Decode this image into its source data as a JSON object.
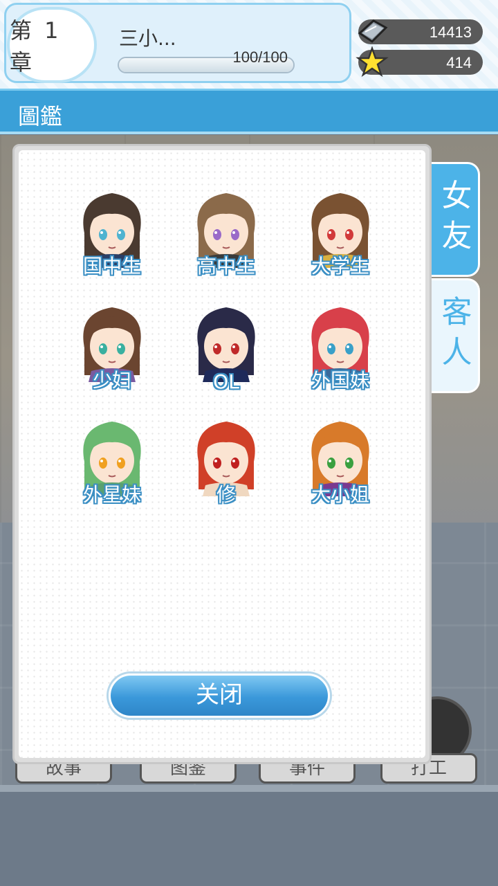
{
  "header": {
    "chapter": "第 1 章",
    "character_name": "三小...",
    "progress_text": "100/100",
    "progress": 1.0
  },
  "currency": {
    "gems": "14413",
    "stars": "414"
  },
  "title": "圖鑑",
  "tabs": [
    {
      "label": "女友",
      "active": true
    },
    {
      "label": "客人",
      "active": false
    }
  ],
  "characters": [
    {
      "label": "国中生",
      "hair": "#4a3a30",
      "eye": "#4fb3d0",
      "outfit": "#2a3f66"
    },
    {
      "label": "高中生",
      "hair": "#8b6a4a",
      "eye": "#9a6ac8",
      "outfit": "#3a3a3a"
    },
    {
      "label": "大学生",
      "hair": "#7a5232",
      "eye": "#d23a3a",
      "outfit": "#d8b040"
    },
    {
      "label": "少妇",
      "hair": "#6b4530",
      "eye": "#3ab0a0",
      "outfit": "#7a5aa0"
    },
    {
      "label": "OL",
      "hair": "#2a2a48",
      "eye": "#c02a2a",
      "outfit": "#1e2a5a"
    },
    {
      "label": "外国妹",
      "hair": "#d8404a",
      "eye": "#3aa0c8",
      "outfit": "#3a6a9a"
    },
    {
      "label": "外星妹",
      "hair": "#6ab870",
      "eye": "#f0a020",
      "outfit": "#5aa070"
    },
    {
      "label": "修",
      "hair": "#d04028",
      "eye": "#c02020",
      "outfit": "#f0d8c0"
    },
    {
      "label": "大小姐",
      "hair": "#d87a2a",
      "eye": "#3aa040",
      "outfit": "#7a3a90"
    }
  ],
  "close_label": "关闭",
  "bottom_nav": [
    "故事",
    "图鉴",
    "事件",
    "打工"
  ]
}
